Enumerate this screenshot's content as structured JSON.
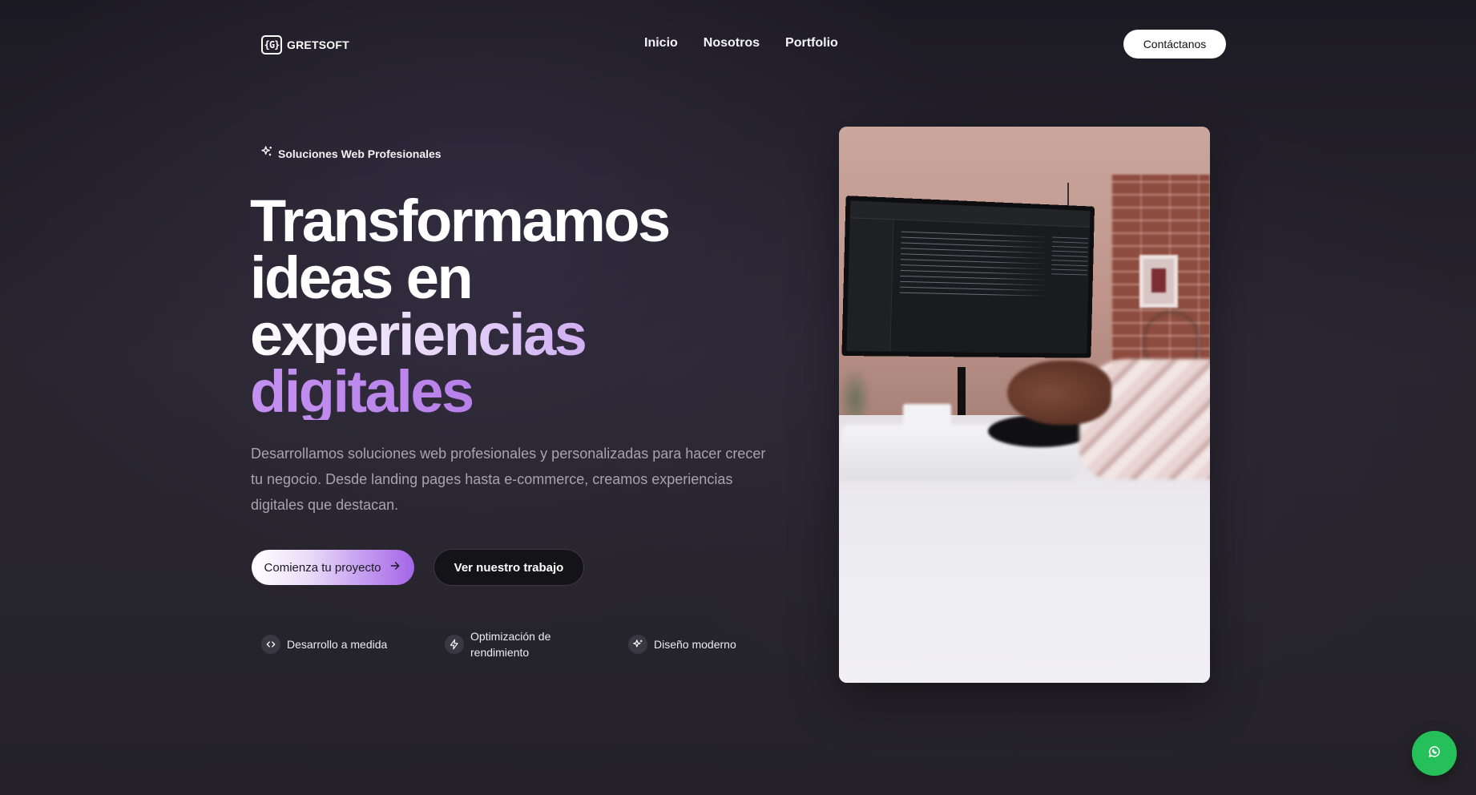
{
  "brand": {
    "logo_mark": "{G}",
    "name": "GRETSOFT"
  },
  "nav": {
    "links": [
      {
        "label": "Inicio"
      },
      {
        "label": "Nosotros"
      },
      {
        "label": "Portfolio"
      }
    ],
    "contact_label": "Contáctanos"
  },
  "hero": {
    "badge": {
      "icon": "sparkles-icon",
      "label": "Soluciones Web Profesionales"
    },
    "headline": {
      "line1": "Transformamos",
      "line2": "ideas en",
      "line3": "experiencias",
      "line4": "digitales"
    },
    "description": "Desarrollamos soluciones web profesionales y personalizadas para hacer crecer tu negocio. Desde landing pages hasta e-commerce, creamos experiencias digitales que destacan.",
    "primary_cta": {
      "label": "Comienza tu proyecto",
      "icon": "arrow-right-icon"
    },
    "secondary_cta": {
      "label": "Ver nuestro trabajo"
    },
    "features": [
      {
        "icon": "code-icon",
        "label": "Desarrollo a medida"
      },
      {
        "icon": "lightning-icon",
        "label": "Optimización de rendimiento"
      },
      {
        "icon": "sparkles-icon",
        "label": "Diseño moderno"
      }
    ]
  },
  "floating": {
    "whatsapp_icon": "whatsapp-icon"
  },
  "colors": {
    "accent_purple": "#a565e8",
    "whatsapp_green": "#25c05a",
    "background": "#1c1a23"
  }
}
